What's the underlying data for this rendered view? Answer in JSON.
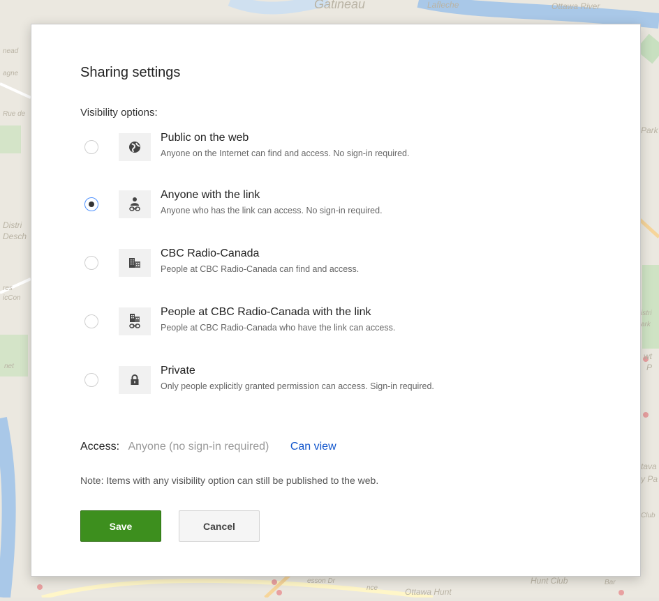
{
  "map": {
    "labels": [
      "Gatineau",
      "Lafleche",
      "Ottawa River",
      "Rue de",
      "Distri",
      "Desch",
      "res",
      "icCon",
      "net",
      "Park",
      "istri",
      "ark",
      "wt",
      "P",
      "tava",
      "y Pa",
      "Club",
      "Ottawa Hunt",
      "Hunt Club",
      "Bar",
      "esson Dr",
      "nce",
      "agne",
      "nead"
    ]
  },
  "dialog": {
    "title": "Sharing settings",
    "visibility_label": "Visibility options:",
    "options": [
      {
        "title": "Public on the web",
        "description": "Anyone on the Internet can find and access. No sign-in required.",
        "icon": "globe-icon",
        "selected": false
      },
      {
        "title": "Anyone with the link",
        "description": "Anyone who has the link can access. No sign-in required.",
        "icon": "person-link-icon",
        "selected": true
      },
      {
        "title": "CBC Radio-Canada",
        "description": "People at CBC Radio-Canada can find and access.",
        "icon": "building-icon",
        "selected": false
      },
      {
        "title": "People at CBC Radio-Canada with the link",
        "description": "People at CBC Radio-Canada who have the link can access.",
        "icon": "building-link-icon",
        "selected": false
      },
      {
        "title": "Private",
        "description": "Only people explicitly granted permission can access. Sign-in required.",
        "icon": "lock-icon",
        "selected": false
      }
    ],
    "access": {
      "label": "Access:",
      "value": "Anyone (no sign-in required)",
      "permission": "Can view"
    },
    "note": "Note: Items with any visibility option can still be published to the web.",
    "buttons": {
      "save": "Save",
      "cancel": "Cancel"
    }
  },
  "colors": {
    "save_green": "#3d8f1e",
    "link_blue": "#1155cc",
    "radio_selected": "#4d90fe"
  }
}
